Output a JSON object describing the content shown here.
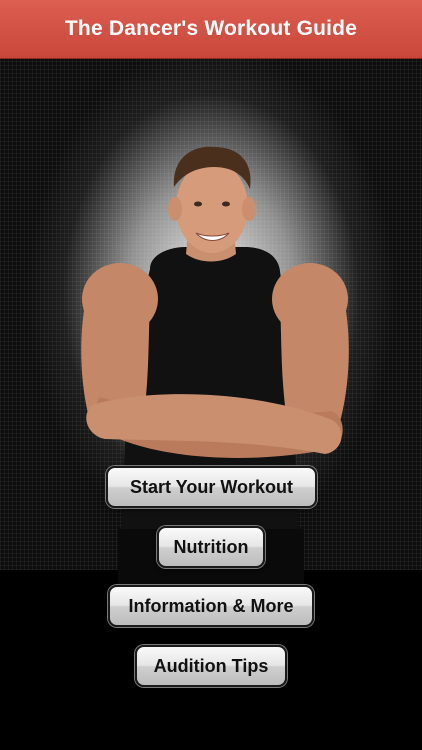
{
  "app": {
    "title": "The Dancer's Workout Guide"
  },
  "colors": {
    "nav_bar": "#d4564a",
    "background": "#0d0d0d",
    "button_face": "#e6e6e6",
    "button_text": "#111111"
  },
  "hero": {
    "image": "photo of man in black tank top with arms crossed"
  },
  "menu": {
    "buttons": [
      {
        "label": "Start Your Workout"
      },
      {
        "label": "Nutrition"
      },
      {
        "label": "Information & More"
      },
      {
        "label": "Audition Tips"
      }
    ]
  }
}
